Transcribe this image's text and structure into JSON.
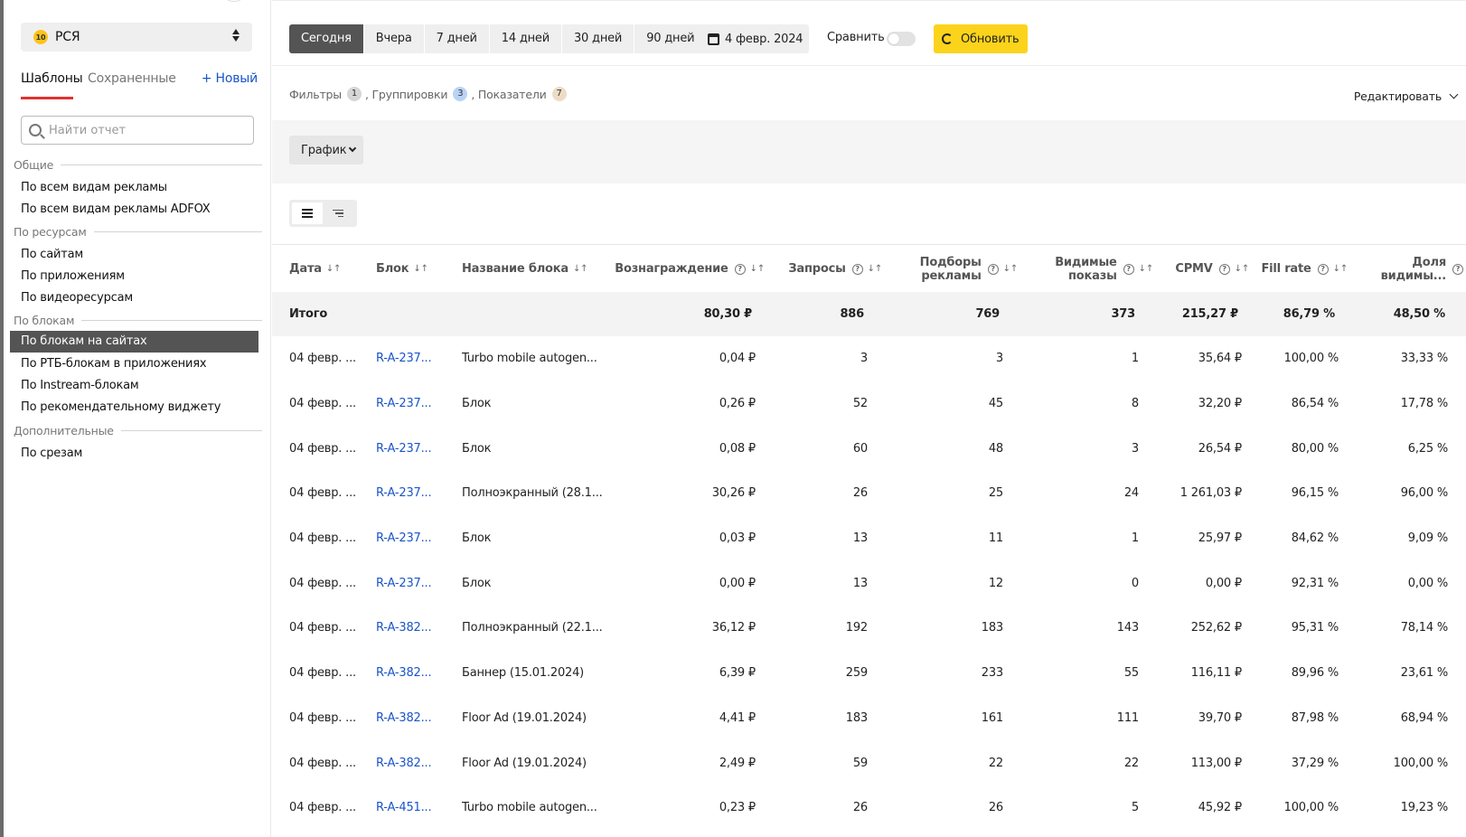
{
  "sidebar": {
    "resource": {
      "badge": "10",
      "label": "РСЯ"
    },
    "tabs": [
      "Шаблоны",
      "Сохраненные",
      "+ Новый"
    ],
    "search_placeholder": "Найти отчет",
    "groups": [
      {
        "title": "Общие",
        "items": [
          "По всем видам рекламы",
          "По всем видам рекламы ADFOX"
        ]
      },
      {
        "title": "По ресурсам",
        "items": [
          "По сайтам",
          "По приложениям",
          "По видеоресурсам"
        ]
      },
      {
        "title": "По блокам",
        "items": [
          "По блокам на сайтах",
          "По РТБ-блокам в приложениях",
          "По Instream-блокам",
          "По рекомендательному виджету"
        ]
      },
      {
        "title": "Дополнительные",
        "items": [
          "По срезам"
        ]
      }
    ],
    "active_item": "По блокам на сайтах"
  },
  "toolbar": {
    "periods": [
      "Сегодня",
      "Вчера",
      "7 дней",
      "14 дней",
      "30 дней",
      "90 дней"
    ],
    "active_period": "Сегодня",
    "date": "4 февр. 2024",
    "compare_label": "Сравнить",
    "compare_enabled": false,
    "refresh_label": "Обновить"
  },
  "filters": {
    "filters_label": "Фильтры",
    "filters_count": "1",
    "groupings_label": ", Группировки",
    "groupings_count": "3",
    "metrics_label": ", Показатели",
    "metrics_count": "7",
    "edit_label": "Редактировать"
  },
  "chart_button": "График",
  "table": {
    "headers": {
      "date": "Дата",
      "block": "Блок",
      "block_name": "Название блока",
      "reward": "Вознаграждение",
      "requests": "Запросы",
      "ad_picks_1": "Подборы",
      "ad_picks_2": "рекламы",
      "visible_1": "Видимые",
      "visible_2": "показы",
      "cpmv": "CPMV",
      "fill_rate": "Fill rate",
      "share_1": "Доля",
      "share_2": "видимы..."
    },
    "total": {
      "label": "Итого",
      "reward": "80,30 ₽",
      "requests": "886",
      "picks": "769",
      "visible": "373",
      "cpmv": "215,27 ₽",
      "fill": "86,79 %",
      "share": "48,50 %"
    },
    "rows": [
      {
        "date": "04 февр. ...",
        "block": "R-A-237...",
        "name": "Turbo mobile autogen...",
        "reward": "0,04 ₽",
        "requests": "3",
        "picks": "3",
        "visible": "1",
        "cpmv": "35,64 ₽",
        "fill": "100,00 %",
        "share": "33,33 %"
      },
      {
        "date": "04 февр. ...",
        "block": "R-A-237...",
        "name": "Блок",
        "reward": "0,26 ₽",
        "requests": "52",
        "picks": "45",
        "visible": "8",
        "cpmv": "32,20 ₽",
        "fill": "86,54 %",
        "share": "17,78 %"
      },
      {
        "date": "04 февр. ...",
        "block": "R-A-237...",
        "name": "Блок",
        "reward": "0,08 ₽",
        "requests": "60",
        "picks": "48",
        "visible": "3",
        "cpmv": "26,54 ₽",
        "fill": "80,00 %",
        "share": "6,25 %"
      },
      {
        "date": "04 февр. ...",
        "block": "R-A-237...",
        "name": "Полноэкранный (28.1...",
        "reward": "30,26 ₽",
        "requests": "26",
        "picks": "25",
        "visible": "24",
        "cpmv": "1 261,03 ₽",
        "fill": "96,15 %",
        "share": "96,00 %"
      },
      {
        "date": "04 февр. ...",
        "block": "R-A-237...",
        "name": "Блок",
        "reward": "0,03 ₽",
        "requests": "13",
        "picks": "11",
        "visible": "1",
        "cpmv": "25,97 ₽",
        "fill": "84,62 %",
        "share": "9,09 %"
      },
      {
        "date": "04 февр. ...",
        "block": "R-A-237...",
        "name": "Блок",
        "reward": "0,00 ₽",
        "requests": "13",
        "picks": "12",
        "visible": "0",
        "cpmv": "0,00 ₽",
        "fill": "92,31 %",
        "share": "0,00 %"
      },
      {
        "date": "04 февр. ...",
        "block": "R-A-382...",
        "name": "Полноэкранный (22.1...",
        "reward": "36,12 ₽",
        "requests": "192",
        "picks": "183",
        "visible": "143",
        "cpmv": "252,62 ₽",
        "fill": "95,31 %",
        "share": "78,14 %"
      },
      {
        "date": "04 февр. ...",
        "block": "R-A-382...",
        "name": "Баннер (15.01.2024)",
        "reward": "6,39 ₽",
        "requests": "259",
        "picks": "233",
        "visible": "55",
        "cpmv": "116,11 ₽",
        "fill": "89,96 %",
        "share": "23,61 %"
      },
      {
        "date": "04 февр. ...",
        "block": "R-A-382...",
        "name": "Floor Ad (19.01.2024)",
        "reward": "4,41 ₽",
        "requests": "183",
        "picks": "161",
        "visible": "111",
        "cpmv": "39,70 ₽",
        "fill": "87,98 %",
        "share": "68,94 %"
      },
      {
        "date": "04 февр. ...",
        "block": "R-A-382...",
        "name": "Floor Ad (19.01.2024)",
        "reward": "2,49 ₽",
        "requests": "59",
        "picks": "22",
        "visible": "22",
        "cpmv": "113,00 ₽",
        "fill": "37,29 %",
        "share": "100,00 %"
      },
      {
        "date": "04 февр. ...",
        "block": "R-A-451...",
        "name": "Turbo mobile autogen...",
        "reward": "0,23 ₽",
        "requests": "26",
        "picks": "26",
        "visible": "5",
        "cpmv": "45,92 ₽",
        "fill": "100,00 %",
        "share": "19,23 %"
      }
    ]
  },
  "colors": {
    "accent": "#fcd31b",
    "link": "#1a55c8",
    "tab_underline": "#e0322f",
    "active_dark": "#545454"
  }
}
